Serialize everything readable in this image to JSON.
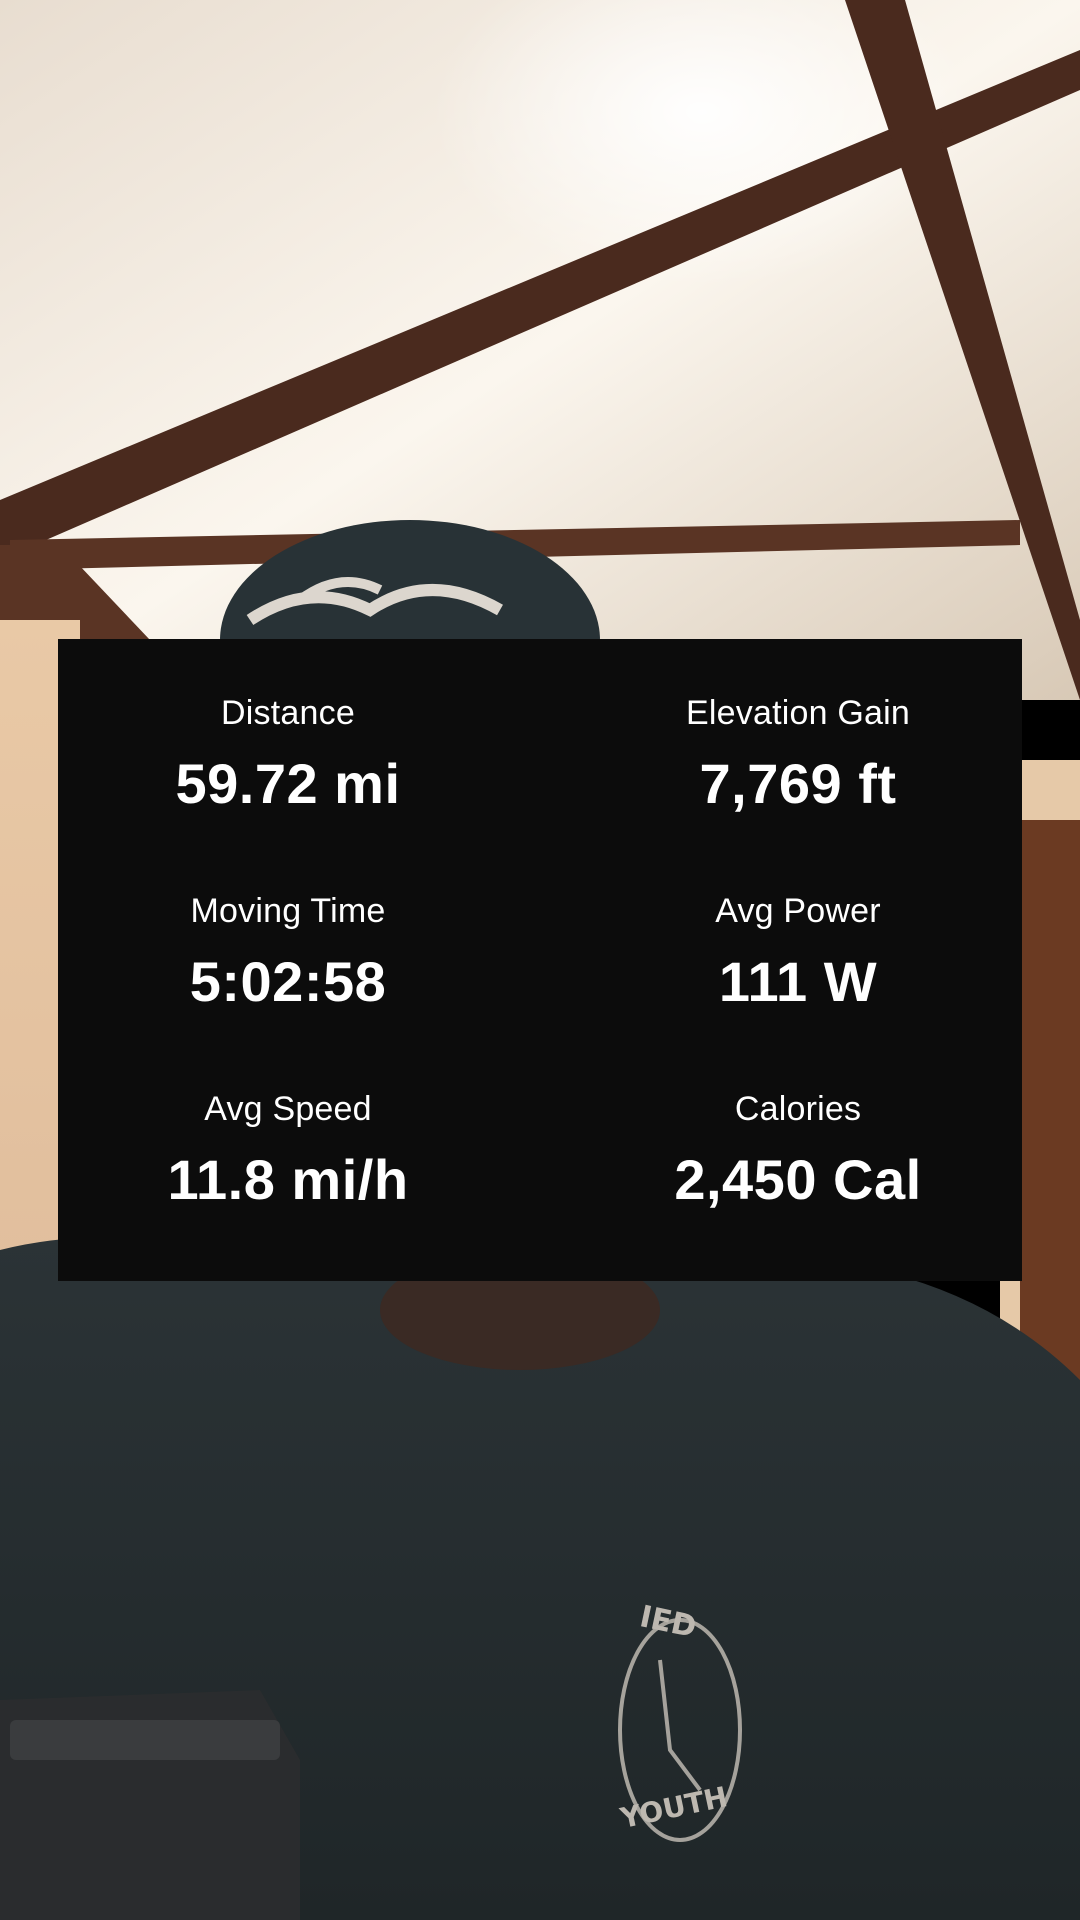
{
  "stats": {
    "distance": {
      "label": "Distance",
      "value": "59.72 mi"
    },
    "elevation": {
      "label": "Elevation Gain",
      "value": "7,769 ft"
    },
    "moving": {
      "label": "Moving Time",
      "value": "5:02:58"
    },
    "power": {
      "label": "Avg Power",
      "value": "111 W"
    },
    "speed": {
      "label": "Avg Speed",
      "value": "11.8 mi/h"
    },
    "calories": {
      "label": "Calories",
      "value": "2,450 Cal"
    }
  },
  "colors": {
    "card_background": "#0c0c0c",
    "text": "#ffffff"
  },
  "background": {
    "description_icon": "selfie-photo",
    "shirt_print_text": [
      "IED",
      "YOUTH"
    ]
  }
}
